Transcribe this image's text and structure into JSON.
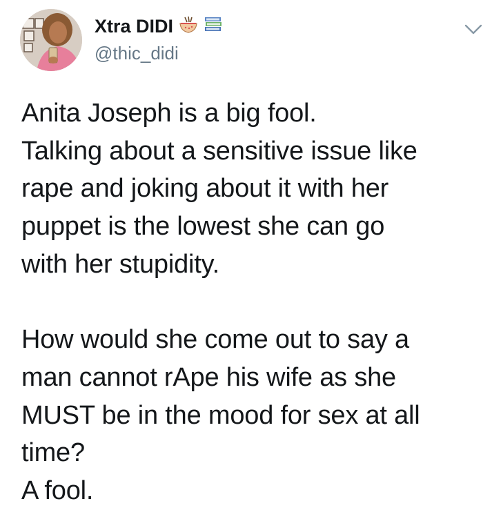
{
  "tweet": {
    "author": {
      "display_name": "Xtra DIDI",
      "handle": "@thic_didi",
      "name_emojis": [
        "noodle-bowl-emoji",
        "books-emoji"
      ],
      "avatar": "profile-photo"
    },
    "menu_icon": "chevron-down-icon",
    "paragraphs": [
      [
        "Anita Joseph is a big fool.",
        "Talking about a sensitive issue like",
        "rape and joking about it with her",
        "puppet is the lowest she can go",
        "with her stupidity."
      ],
      [
        "How would she come out to say a",
        "man cannot rApe his wife as she",
        "MUST be in the mood for sex at all",
        "time?",
        "A fool."
      ]
    ]
  },
  "colors": {
    "text": "#14171a",
    "secondary_text": "#657786",
    "background": "#ffffff"
  }
}
